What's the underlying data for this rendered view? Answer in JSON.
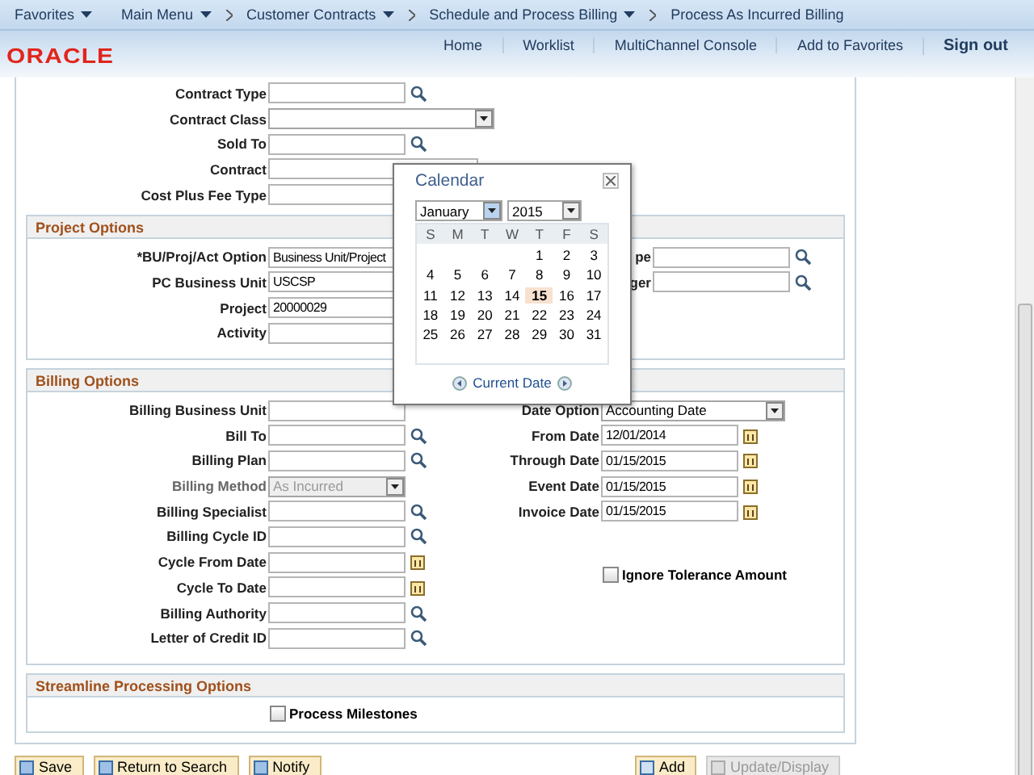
{
  "nav": [
    {
      "label": "Favorites",
      "menu": true
    },
    {
      "label": "Main Menu",
      "menu": true
    },
    {
      "label": "Customer Contracts",
      "menu": true
    },
    {
      "label": "Schedule and Process Billing",
      "menu": true
    },
    {
      "label": "Process As Incurred Billing",
      "menu": false
    }
  ],
  "logo": "ORACLE",
  "header_links": [
    {
      "label": "Home",
      "strong": false
    },
    {
      "label": "Worklist",
      "strong": false
    },
    {
      "label": "MultiChannel Console",
      "strong": false
    },
    {
      "label": "Add to Favorites",
      "strong": false
    },
    {
      "label": "Sign out",
      "strong": true
    }
  ],
  "contract_fields": [
    {
      "label": "Contract Type",
      "kind": "lookup"
    },
    {
      "label": "Contract Class",
      "kind": "select"
    },
    {
      "label": "Sold To",
      "kind": "lookup"
    },
    {
      "label": "Contract",
      "kind": "wide"
    },
    {
      "label": "Cost Plus Fee Type",
      "kind": "wide"
    }
  ],
  "project_options": {
    "title": "Project Options",
    "left_fields": [
      {
        "label": "*BU/Proj/Act Option",
        "kind": "wide",
        "value": "Business Unit/Project"
      },
      {
        "label": "PC Business Unit",
        "kind": "wide",
        "value": "USCSP"
      },
      {
        "label": "Project",
        "kind": "wide",
        "value": "20000029"
      },
      {
        "label": "Activity",
        "kind": "wide"
      }
    ],
    "right_fields": [
      {
        "label": "pe",
        "kind": "lookup"
      },
      {
        "label": "ger",
        "kind": "lookup"
      }
    ]
  },
  "billing_options": {
    "title": "Billing Options",
    "left_fields": [
      {
        "label": "Billing Business Unit",
        "kind": "text",
        "disabled": false
      },
      {
        "label": "Bill To",
        "kind": "lookup",
        "disabled": false
      },
      {
        "label": "Billing Plan",
        "kind": "lookup",
        "disabled": false
      },
      {
        "label": "Billing Method",
        "kind": "select",
        "value": "As Incurred",
        "disabled": true
      },
      {
        "label": "Billing Specialist",
        "kind": "lookup",
        "disabled": false
      },
      {
        "label": "Billing Cycle ID",
        "kind": "lookup",
        "disabled": false
      },
      {
        "label": "Cycle From Date",
        "kind": "date",
        "disabled": false
      },
      {
        "label": "Cycle To Date",
        "kind": "date",
        "disabled": false
      },
      {
        "label": "Billing Authority",
        "kind": "lookup",
        "disabled": false
      },
      {
        "label": "Letter of Credit ID",
        "kind": "lookup",
        "disabled": false
      }
    ],
    "right_fields": [
      {
        "label": "Date Option",
        "kind": "select",
        "value": "Accounting Date",
        "disabled": false
      },
      {
        "label": "From Date",
        "kind": "date",
        "value": "12/01/2014",
        "disabled": false
      },
      {
        "label": "Through Date",
        "kind": "date",
        "value": "01/15/2015",
        "disabled": false
      },
      {
        "label": "Event Date",
        "kind": "date",
        "value": "01/15/2015",
        "disabled": false
      },
      {
        "label": "Invoice Date",
        "kind": "date",
        "value": "01/15/2015",
        "disabled": false
      }
    ],
    "checkbox": {
      "label": "Ignore Tolerance Amount",
      "checked": false
    }
  },
  "streamline": {
    "title": "Streamline Processing Options",
    "checkbox": {
      "label": "Process Milestones",
      "checked": false
    }
  },
  "calendar": {
    "title": "Calendar",
    "month": "January",
    "year": "2015",
    "weekdays": [
      "S",
      "M",
      "T",
      "W",
      "T",
      "F",
      "S"
    ],
    "weeks": [
      {
        "days": [
          {
            "day": "1",
            "selected": false
          },
          {
            "day": "2",
            "selected": false
          },
          {
            "day": "3",
            "selected": false
          }
        ]
      },
      {
        "days": [
          {
            "day": "4",
            "selected": false
          },
          {
            "day": "5",
            "selected": false
          },
          {
            "day": "6",
            "selected": false
          },
          {
            "day": "7",
            "selected": false
          },
          {
            "day": "8",
            "selected": false
          },
          {
            "day": "9",
            "selected": false
          },
          {
            "day": "10",
            "selected": false
          }
        ]
      },
      {
        "days": [
          {
            "day": "11",
            "selected": false
          },
          {
            "day": "12",
            "selected": false
          },
          {
            "day": "13",
            "selected": false
          },
          {
            "day": "14",
            "selected": false
          },
          {
            "day": "15",
            "selected": true
          },
          {
            "day": "16",
            "selected": false
          },
          {
            "day": "17",
            "selected": false
          }
        ]
      },
      {
        "days": [
          {
            "day": "18",
            "selected": false
          },
          {
            "day": "19",
            "selected": false
          },
          {
            "day": "20",
            "selected": false
          },
          {
            "day": "21",
            "selected": false
          },
          {
            "day": "22",
            "selected": false
          },
          {
            "day": "23",
            "selected": false
          },
          {
            "day": "24",
            "selected": false
          }
        ]
      },
      {
        "days": [
          {
            "day": "25",
            "selected": false
          },
          {
            "day": "26",
            "selected": false
          },
          {
            "day": "27",
            "selected": false
          },
          {
            "day": "28",
            "selected": false
          },
          {
            "day": "29",
            "selected": false
          },
          {
            "day": "30",
            "selected": false
          },
          {
            "day": "31",
            "selected": false
          }
        ]
      }
    ],
    "footer_link": "Current Date"
  },
  "left_buttons": [
    {
      "label": "Save",
      "disabled": false
    },
    {
      "label": "Return to Search",
      "disabled": false
    },
    {
      "label": "Notify",
      "disabled": false
    }
  ],
  "right_buttons": [
    {
      "label": "Add",
      "disabled": false
    },
    {
      "label": "Update/Display",
      "disabled": true
    }
  ]
}
